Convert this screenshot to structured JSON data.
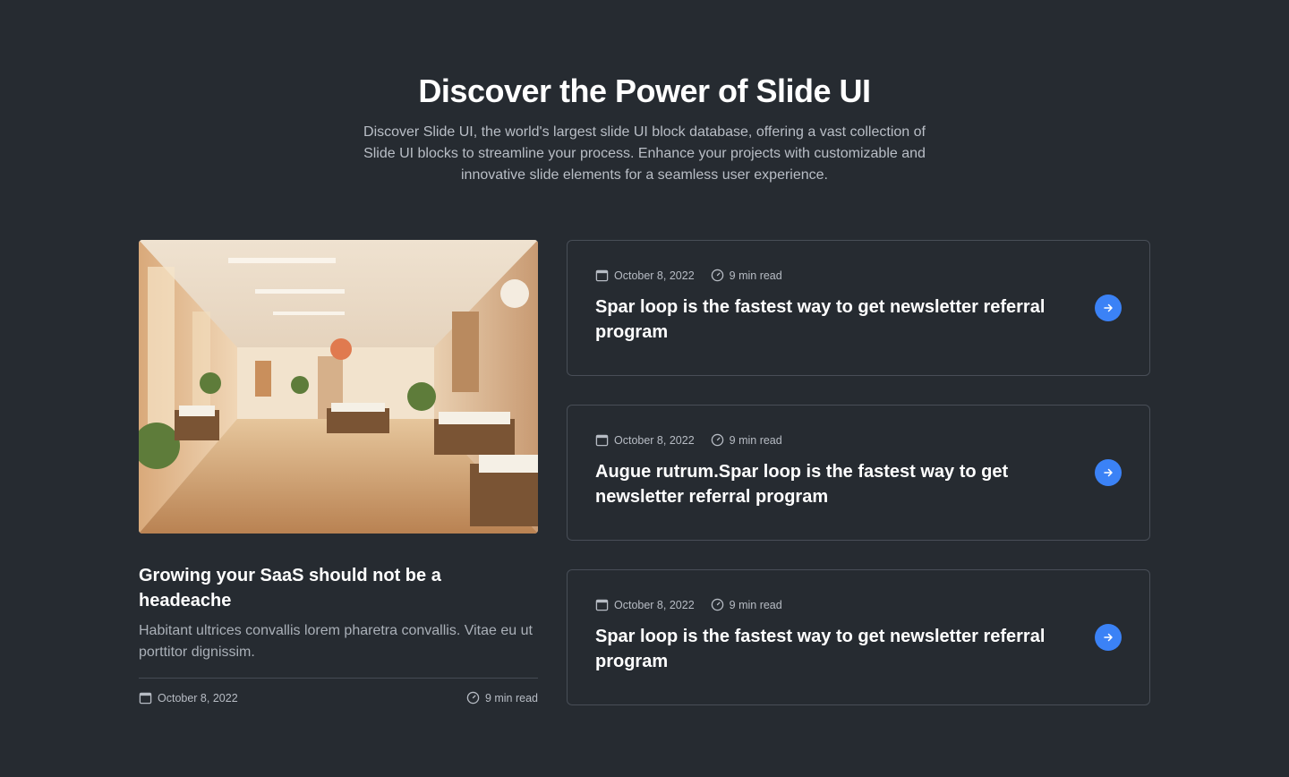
{
  "hero": {
    "title": "Discover the Power of Slide UI",
    "description": "Discover Slide UI, the world's largest slide UI block database, offering a vast collection of Slide UI blocks to streamline your process. Enhance your projects with customizable and innovative slide elements for a seamless user experience."
  },
  "featured": {
    "title": "Growing your SaaS should not be a headeache",
    "excerpt": "Habitant ultrices convallis lorem pharetra convallis. Vitae eu ut porttitor dignissim.",
    "date": "October 8, 2022",
    "read_time": "9 min read",
    "image": "hospital-corridor-photo"
  },
  "posts": [
    {
      "date": "October 8, 2022",
      "read_time": "9 min read",
      "title": "Spar loop is the fastest way to get newsletter referral program"
    },
    {
      "date": "October 8, 2022",
      "read_time": "9 min read",
      "title": "Augue rutrum.Spar loop is the fastest way to get newsletter referral program"
    },
    {
      "date": "October 8, 2022",
      "read_time": "9 min read",
      "title": "Spar loop is the fastest way to get newsletter referral program"
    }
  ],
  "icons": {
    "date": "calendar-icon",
    "read_time": "clock-icon",
    "action": "arrow-right-icon"
  },
  "colors": {
    "background": "#262b31",
    "accent": "#3b82f6",
    "border": "#484e57"
  }
}
